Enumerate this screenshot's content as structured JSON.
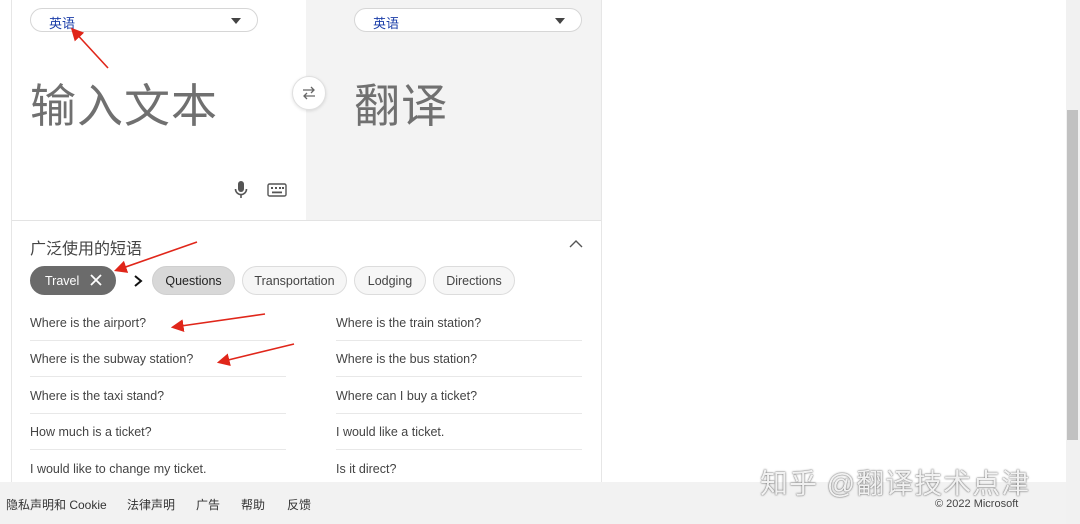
{
  "source_lang": {
    "label": "英语"
  },
  "target_lang": {
    "label": "英语"
  },
  "input": {
    "placeholder": "输入文本"
  },
  "output": {
    "placeholder": "翻译"
  },
  "phrases": {
    "title": "广泛使用的短语",
    "categories": [
      "Travel",
      "Questions",
      "Transportation",
      "Lodging",
      "Directions"
    ],
    "left": [
      "Where is the airport?",
      "Where is the subway station?",
      "Where is the taxi stand?",
      "How much is a ticket?",
      "I would like to change my ticket."
    ],
    "right": [
      "Where is the train station?",
      "Where is the bus station?",
      "Where can I buy a ticket?",
      "I would like a ticket.",
      "Is it direct?"
    ]
  },
  "footer": {
    "links": [
      "隐私声明和 Cookie",
      "法律声明",
      "广告",
      "帮助",
      "反馈"
    ],
    "copyright": "© 2022 Microsoft"
  },
  "watermark": "知乎 @翻译技术点津",
  "colors": {
    "accent": "#1a3da8",
    "annotation": "#e0261a",
    "chip_dark": "#6b6b6b"
  }
}
